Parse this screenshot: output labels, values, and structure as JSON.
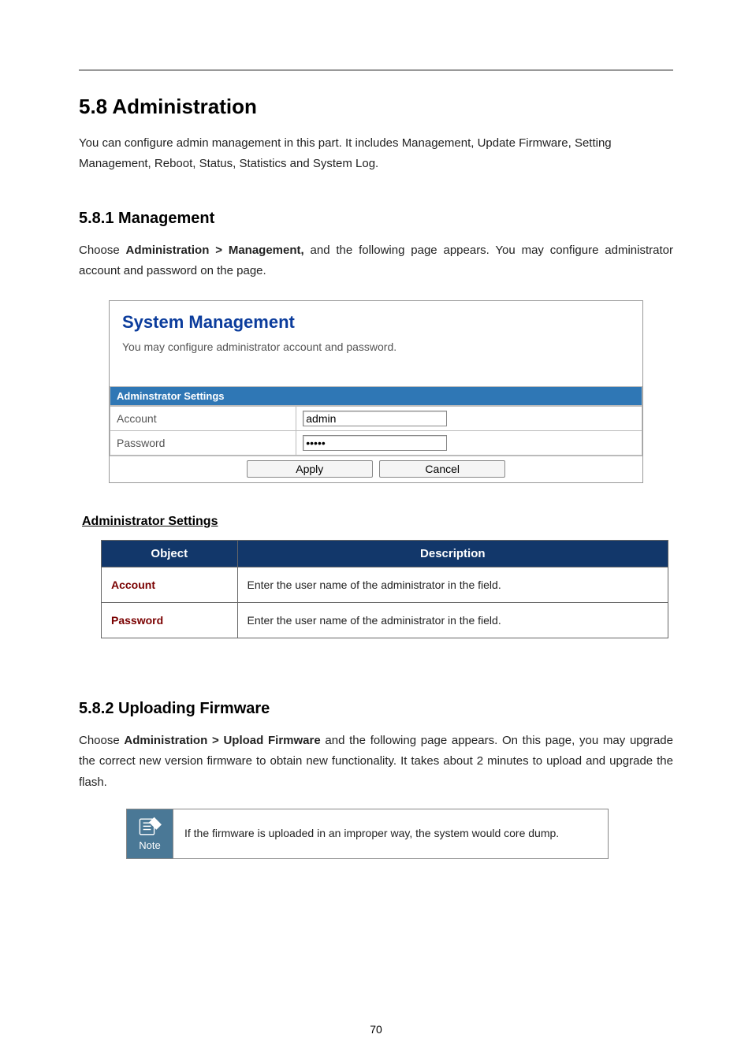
{
  "page_number": "70",
  "heading_main": "5.8 Administration",
  "intro_para": "You can configure admin management in this part. It includes Management, Update Firmware, Setting Management, Reboot, Status, Statistics and System Log.",
  "sub1": {
    "title": "5.8.1 Management",
    "para_pre": "Choose ",
    "para_bold": "Administration > Management,",
    "para_post": " and the following page appears. You may configure administrator account and password on the page."
  },
  "screenshot": {
    "title": "System Management",
    "desc": "You may configure administrator account and password.",
    "section_header": "Adminstrator Settings",
    "rows": {
      "account_label": "Account",
      "account_value": "admin",
      "password_label": "Password",
      "password_value": "•••••"
    },
    "buttons": {
      "apply": "Apply",
      "cancel": "Cancel"
    }
  },
  "admin_settings_heading": "Administrator Settings",
  "table": {
    "header_object": "Object",
    "header_description": "Description",
    "rows": [
      {
        "object": "Account",
        "desc": "Enter the user name of the administrator in the field."
      },
      {
        "object": "Password",
        "desc": "Enter the user name of the administrator in the field."
      }
    ]
  },
  "sub2": {
    "title": "5.8.2 Uploading Firmware",
    "para_pre": "Choose ",
    "para_bold": "Administration > Upload Firmware",
    "para_post": " and the following page appears. On this page, you may upgrade the correct new version firmware to obtain new functionality. It takes about 2 minutes to upload and upgrade the flash."
  },
  "note": {
    "label": "Note",
    "text": "If the firmware is uploaded in an improper way, the system would core dump."
  }
}
